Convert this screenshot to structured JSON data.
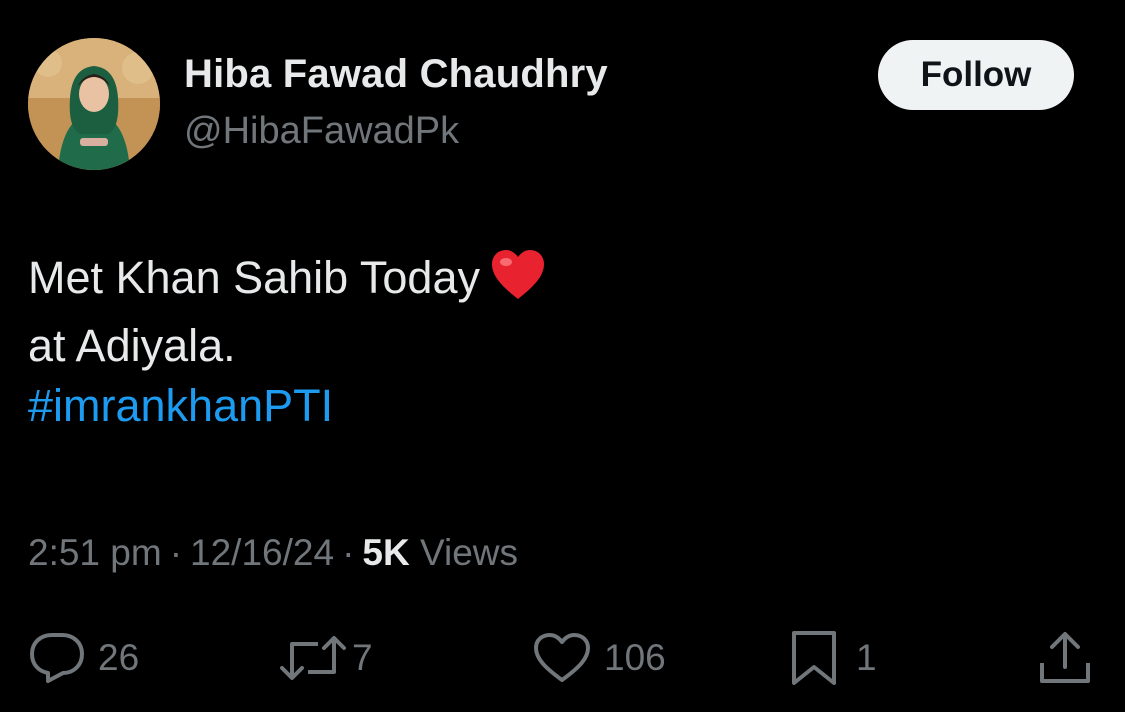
{
  "author": {
    "display_name": "Hiba Fawad Chaudhry",
    "handle": "@HibaFawadPk"
  },
  "follow_label": "Follow",
  "tweet": {
    "line1": "Met Khan Sahib Today",
    "line2": "at Adiyala.",
    "hashtag": "#imrankhanPTI",
    "emoji": "heart-emoji"
  },
  "meta": {
    "time": "2:51 pm",
    "separator": "·",
    "date": "12/16/24",
    "views_count": "5K",
    "views_label": "Views"
  },
  "actions": {
    "replies": "26",
    "reposts": "7",
    "likes": "106",
    "bookmarks": "1"
  },
  "colors": {
    "background": "#000000",
    "primary_text": "#e7e9ea",
    "secondary_text": "#71767b",
    "link": "#1d9bf0",
    "follow_button_bg": "#eff3f4",
    "heart": "#e8222e"
  },
  "icons": [
    "reply-icon",
    "repost-icon",
    "like-icon",
    "bookmark-icon",
    "share-icon"
  ]
}
